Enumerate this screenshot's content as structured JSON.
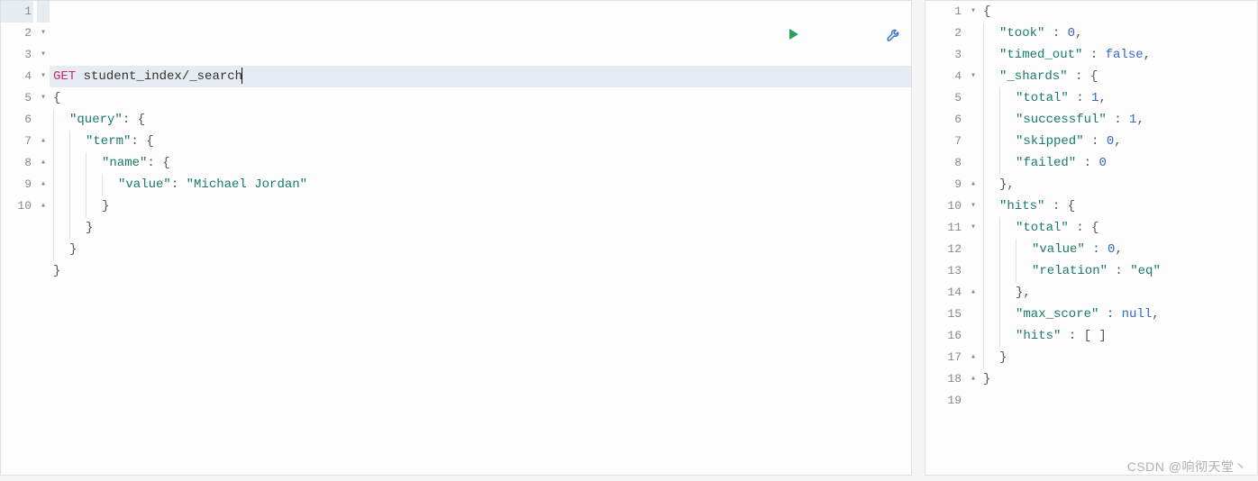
{
  "watermark": "CSDN @响彻天堂丶",
  "left": {
    "lines": [
      {
        "n": "1",
        "fold": "",
        "hl": true,
        "tokens": [
          {
            "t": "GET",
            "c": "method"
          },
          {
            "t": " student_index/_search"
          },
          {
            "t": "",
            "c": "cursor"
          }
        ]
      },
      {
        "n": "2",
        "fold": "▾",
        "tokens": [
          {
            "t": "{",
            "c": "punct"
          }
        ]
      },
      {
        "n": "3",
        "fold": "▾",
        "tokens": [
          {
            "pad": 1
          },
          {
            "t": "\"query\"",
            "c": "keystr"
          },
          {
            "t": ": {",
            "c": "punct"
          }
        ]
      },
      {
        "n": "4",
        "fold": "▾",
        "tokens": [
          {
            "pad": 2
          },
          {
            "t": "\"term\"",
            "c": "keystr"
          },
          {
            "t": ": {",
            "c": "punct"
          }
        ]
      },
      {
        "n": "5",
        "fold": "▾",
        "tokens": [
          {
            "pad": 3
          },
          {
            "t": "\"name\"",
            "c": "keystr"
          },
          {
            "t": ": {",
            "c": "punct"
          }
        ]
      },
      {
        "n": "6",
        "fold": "",
        "tokens": [
          {
            "pad": 4
          },
          {
            "t": "\"value\"",
            "c": "keystr"
          },
          {
            "t": ": ",
            "c": "punct"
          },
          {
            "t": "\"Michael Jordan\"",
            "c": "valstr"
          }
        ]
      },
      {
        "n": "7",
        "fold": "▴",
        "tokens": [
          {
            "pad": 3
          },
          {
            "t": "}",
            "c": "punct"
          }
        ]
      },
      {
        "n": "8",
        "fold": "▴",
        "tokens": [
          {
            "pad": 2
          },
          {
            "t": "}",
            "c": "punct"
          }
        ]
      },
      {
        "n": "9",
        "fold": "▴",
        "tokens": [
          {
            "pad": 1
          },
          {
            "t": "}",
            "c": "punct"
          }
        ]
      },
      {
        "n": "10",
        "fold": "▴",
        "tokens": [
          {
            "t": "}",
            "c": "punct"
          }
        ]
      }
    ]
  },
  "right": {
    "lines": [
      {
        "n": "1",
        "fold": "▾",
        "tokens": [
          {
            "t": "{",
            "c": "punct"
          }
        ]
      },
      {
        "n": "2",
        "fold": "",
        "tokens": [
          {
            "pad": 1
          },
          {
            "t": "\"took\"",
            "c": "keystr"
          },
          {
            "t": " : ",
            "c": "punct"
          },
          {
            "t": "0",
            "c": "num"
          },
          {
            "t": ",",
            "c": "punct"
          }
        ]
      },
      {
        "n": "3",
        "fold": "",
        "tokens": [
          {
            "pad": 1
          },
          {
            "t": "\"timed_out\"",
            "c": "keystr"
          },
          {
            "t": " : ",
            "c": "punct"
          },
          {
            "t": "false",
            "c": "bool"
          },
          {
            "t": ",",
            "c": "punct"
          }
        ]
      },
      {
        "n": "4",
        "fold": "▾",
        "tokens": [
          {
            "pad": 1
          },
          {
            "t": "\"_shards\"",
            "c": "keystr"
          },
          {
            "t": " : {",
            "c": "punct"
          }
        ]
      },
      {
        "n": "5",
        "fold": "",
        "tokens": [
          {
            "pad": 2
          },
          {
            "t": "\"total\"",
            "c": "keystr"
          },
          {
            "t": " : ",
            "c": "punct"
          },
          {
            "t": "1",
            "c": "num"
          },
          {
            "t": ",",
            "c": "punct"
          }
        ]
      },
      {
        "n": "6",
        "fold": "",
        "tokens": [
          {
            "pad": 2
          },
          {
            "t": "\"successful\"",
            "c": "keystr"
          },
          {
            "t": " : ",
            "c": "punct"
          },
          {
            "t": "1",
            "c": "num"
          },
          {
            "t": ",",
            "c": "punct"
          }
        ]
      },
      {
        "n": "7",
        "fold": "",
        "tokens": [
          {
            "pad": 2
          },
          {
            "t": "\"skipped\"",
            "c": "keystr"
          },
          {
            "t": " : ",
            "c": "punct"
          },
          {
            "t": "0",
            "c": "num"
          },
          {
            "t": ",",
            "c": "punct"
          }
        ]
      },
      {
        "n": "8",
        "fold": "",
        "tokens": [
          {
            "pad": 2
          },
          {
            "t": "\"failed\"",
            "c": "keystr"
          },
          {
            "t": " : ",
            "c": "punct"
          },
          {
            "t": "0",
            "c": "num"
          }
        ]
      },
      {
        "n": "9",
        "fold": "▴",
        "tokens": [
          {
            "pad": 1
          },
          {
            "t": "},",
            "c": "punct"
          }
        ]
      },
      {
        "n": "10",
        "fold": "▾",
        "tokens": [
          {
            "pad": 1
          },
          {
            "t": "\"hits\"",
            "c": "keystr"
          },
          {
            "t": " : {",
            "c": "punct"
          }
        ]
      },
      {
        "n": "11",
        "fold": "▾",
        "tokens": [
          {
            "pad": 2
          },
          {
            "t": "\"total\"",
            "c": "keystr"
          },
          {
            "t": " : {",
            "c": "punct"
          }
        ]
      },
      {
        "n": "12",
        "fold": "",
        "tokens": [
          {
            "pad": 3
          },
          {
            "t": "\"value\"",
            "c": "keystr"
          },
          {
            "t": " : ",
            "c": "punct"
          },
          {
            "t": "0",
            "c": "num"
          },
          {
            "t": ",",
            "c": "punct"
          }
        ]
      },
      {
        "n": "13",
        "fold": "",
        "tokens": [
          {
            "pad": 3
          },
          {
            "t": "\"relation\"",
            "c": "keystr"
          },
          {
            "t": " : ",
            "c": "punct"
          },
          {
            "t": "\"eq\"",
            "c": "valstr"
          }
        ]
      },
      {
        "n": "14",
        "fold": "▴",
        "tokens": [
          {
            "pad": 2
          },
          {
            "t": "},",
            "c": "punct"
          }
        ]
      },
      {
        "n": "15",
        "fold": "",
        "tokens": [
          {
            "pad": 2
          },
          {
            "t": "\"max_score\"",
            "c": "keystr"
          },
          {
            "t": " : ",
            "c": "punct"
          },
          {
            "t": "null",
            "c": "null"
          },
          {
            "t": ",",
            "c": "punct"
          }
        ]
      },
      {
        "n": "16",
        "fold": "",
        "tokens": [
          {
            "pad": 2
          },
          {
            "t": "\"hits\"",
            "c": "keystr"
          },
          {
            "t": " : [ ]",
            "c": "punct"
          }
        ]
      },
      {
        "n": "17",
        "fold": "▴",
        "tokens": [
          {
            "pad": 1
          },
          {
            "t": "}",
            "c": "punct"
          }
        ]
      },
      {
        "n": "18",
        "fold": "▴",
        "tokens": [
          {
            "t": "}",
            "c": "punct"
          }
        ]
      },
      {
        "n": "19",
        "fold": "",
        "tokens": []
      }
    ]
  },
  "icons": {
    "run": "run-icon",
    "wrench": "wrench-icon"
  }
}
